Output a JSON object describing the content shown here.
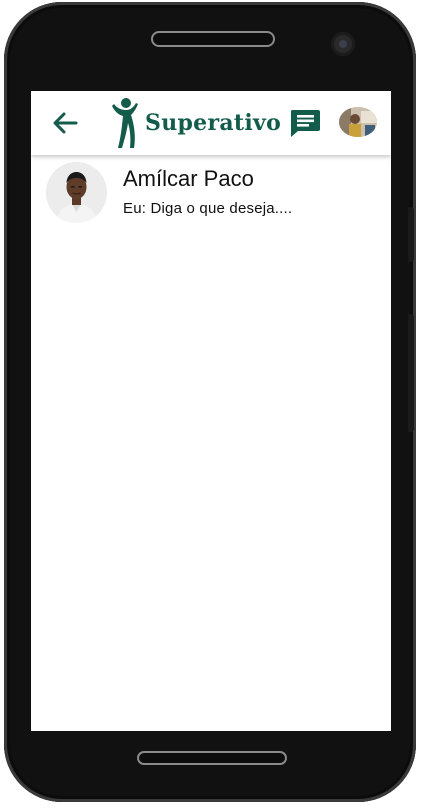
{
  "app": {
    "brand_name": "Superativo",
    "accent_color": "#135c4c"
  },
  "header": {
    "back_icon": "arrow-back-icon",
    "logo_icon": "person-figure-logo-icon",
    "chat_icon": "chat-bubble-icon",
    "profile_avatar": "user-profile-photo"
  },
  "conversations": [
    {
      "name": "Amílcar Paco",
      "preview": "Eu: Diga o que deseja....",
      "avatar": "contact-photo"
    }
  ]
}
